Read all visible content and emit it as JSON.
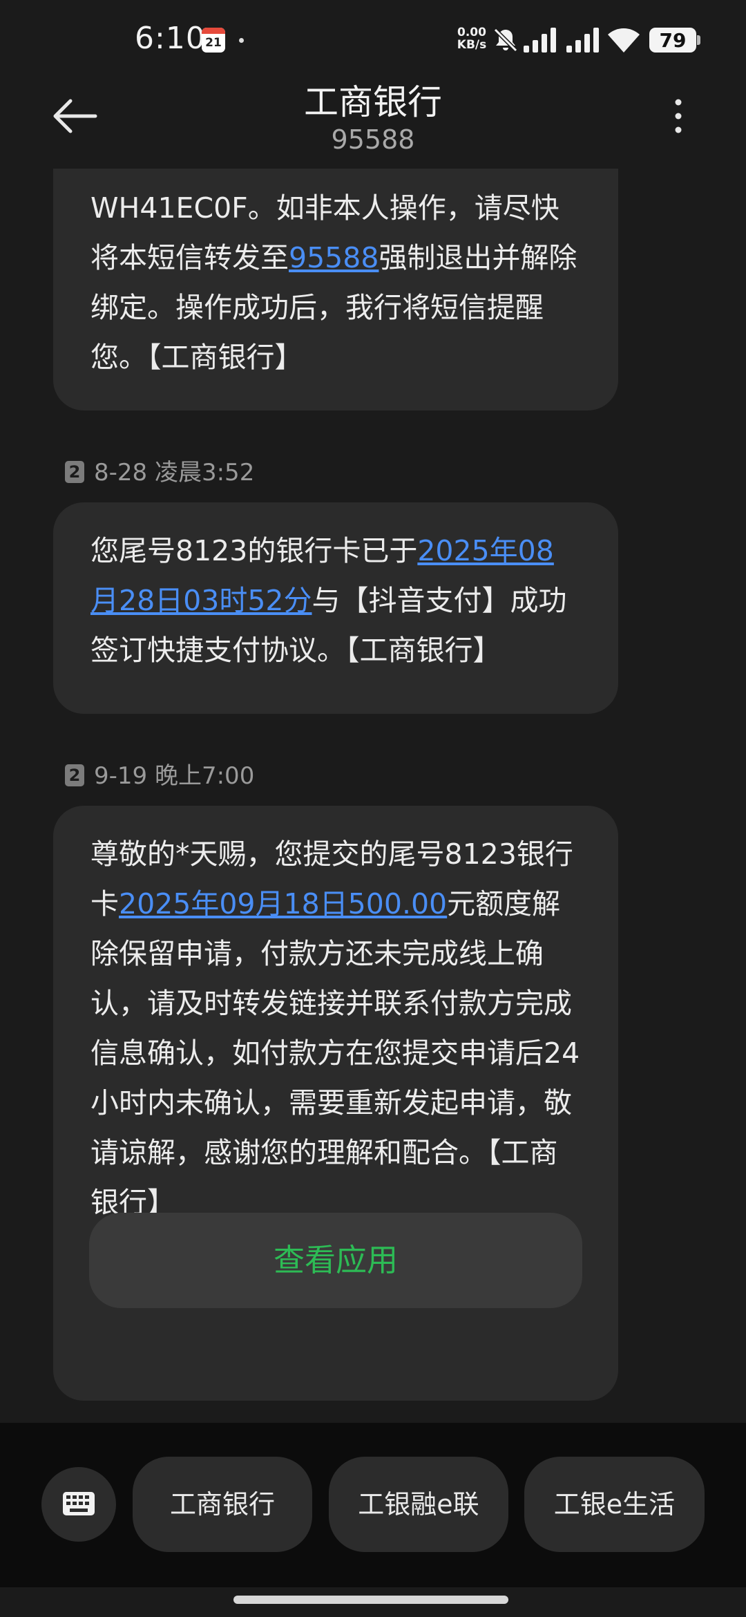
{
  "status_bar": {
    "time": "6:10",
    "calendar_day": "21",
    "net_speed_value": "0.00",
    "net_speed_unit": "KB/s",
    "battery": "79"
  },
  "header": {
    "title": "工商银行",
    "number": "95588"
  },
  "messages": [
    {
      "parts": [
        {
          "text": "WH41EC0F。如非本人操作，请尽快将本短信转发至"
        },
        {
          "text": "95588",
          "link": true
        },
        {
          "text": "强制退出并解除绑定。操作成功后，我行将短信提醒您。【工商银行】"
        }
      ]
    },
    {
      "sim": "2",
      "time": "8-28 凌晨3:52",
      "parts": [
        {
          "text": "您尾号8123的银行卡已于"
        },
        {
          "text": "2025年08月28日03时52分",
          "link": true
        },
        {
          "text": "与【抖音支付】成功签订快捷支付协议。【工商银行】"
        }
      ]
    },
    {
      "sim": "2",
      "time": "9-19 晚上7:00",
      "parts": [
        {
          "text": "尊敬的*天赐，您提交的尾号8123银行卡"
        },
        {
          "text": "2025年09月18日500.00",
          "link": true
        },
        {
          "text": "元额度解除保留申请，付款方还未完成线上确认，请及时转发链接并联系付款方完成信息确认，如付款方在您提交申请后24小时内未确认，需要重新发起申请，敬请谅解，感谢您的理解和配合。【工商银行】"
        }
      ],
      "action_label": "查看应用"
    }
  ],
  "quick_actions": [
    "工商银行",
    "工银融e联",
    "工银e生活"
  ],
  "colors": {
    "link": "#4a8ef5",
    "action_green": "#2dbb55",
    "bubble": "#2b2b2b",
    "background": "#1b1b1b"
  }
}
